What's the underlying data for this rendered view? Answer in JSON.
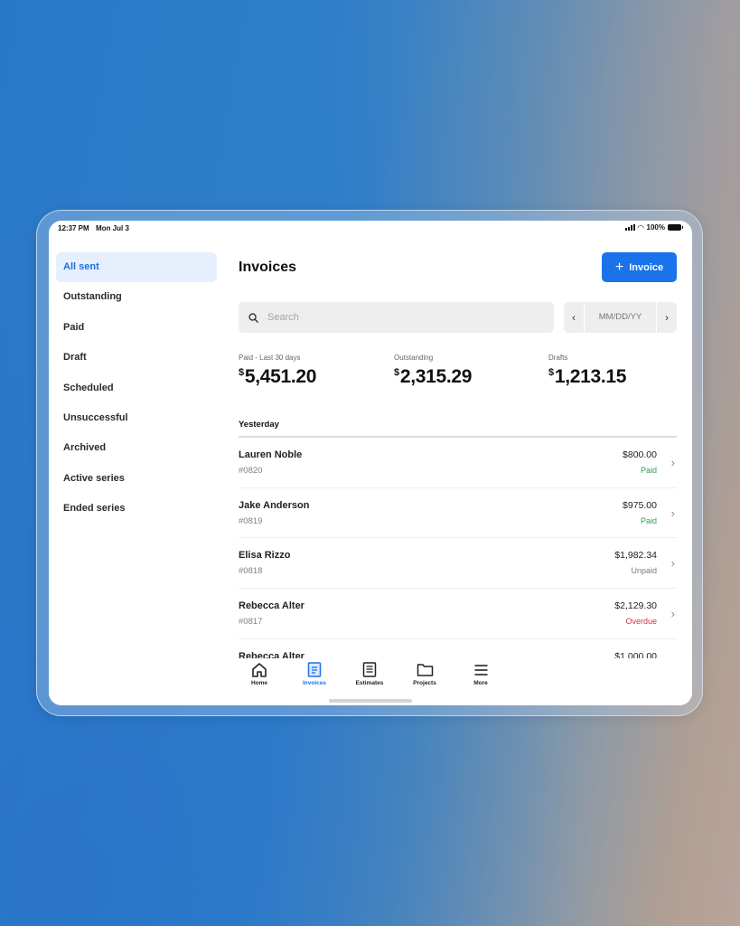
{
  "status_bar": {
    "time": "12:37 PM",
    "date": "Mon Jul 3",
    "battery": "100%"
  },
  "sidebar": {
    "items": [
      {
        "label": "All sent",
        "active": true
      },
      {
        "label": "Outstanding",
        "active": false
      },
      {
        "label": "Paid",
        "active": false
      },
      {
        "label": "Draft",
        "active": false
      },
      {
        "label": "Scheduled",
        "active": false
      },
      {
        "label": "Unsuccessful",
        "active": false
      },
      {
        "label": "Archived",
        "active": false
      },
      {
        "label": "Active series",
        "active": false
      },
      {
        "label": "Ended series",
        "active": false
      }
    ]
  },
  "header": {
    "title": "Invoices",
    "new_button_label": "Invoice"
  },
  "search": {
    "placeholder": "Search"
  },
  "date_filter": {
    "placeholder": "MM/DD/YY",
    "prev": "‹",
    "next": "›"
  },
  "stats": [
    {
      "label": "Paid - Last 30 days",
      "currency": "$",
      "value": "5,451.20"
    },
    {
      "label": "Outstanding",
      "currency": "$",
      "value": "2,315.29"
    },
    {
      "label": "Drafts",
      "currency": "$",
      "value": "1,213.15"
    }
  ],
  "section_heading": "Yesterday",
  "invoices": [
    {
      "name": "Lauren Noble",
      "number": "#0820",
      "amount": "$800.00",
      "status": "Paid",
      "status_color": "#2e9e4f"
    },
    {
      "name": "Jake Anderson",
      "number": "#0819",
      "amount": "$975.00",
      "status": "Paid",
      "status_color": "#2e9e4f"
    },
    {
      "name": "Elisa Rizzo",
      "number": "#0818",
      "amount": "$1,982.34",
      "status": "Unpaid",
      "status_color": "#7a7a7a"
    },
    {
      "name": "Rebecca Alter",
      "number": "#0817",
      "amount": "$2,129.30",
      "status": "Overdue",
      "status_color": "#d2314f"
    },
    {
      "name": "Rebecca Alter",
      "number": "",
      "amount": "$1,000.00",
      "status": "",
      "status_color": "#7a7a7a"
    }
  ],
  "tabs": [
    {
      "label": "Home",
      "icon": "home-icon",
      "active": false
    },
    {
      "label": "Invoices",
      "icon": "invoice-icon",
      "active": true
    },
    {
      "label": "Estimates",
      "icon": "estimate-icon",
      "active": false
    },
    {
      "label": "Projects",
      "icon": "folder-icon",
      "active": false
    },
    {
      "label": "More",
      "icon": "menu-icon",
      "active": false
    }
  ],
  "colors": {
    "accent": "#1a73e8",
    "sidebar_active_bg": "#e6f0fc",
    "paid": "#2e9e4f",
    "overdue": "#d2314f"
  }
}
